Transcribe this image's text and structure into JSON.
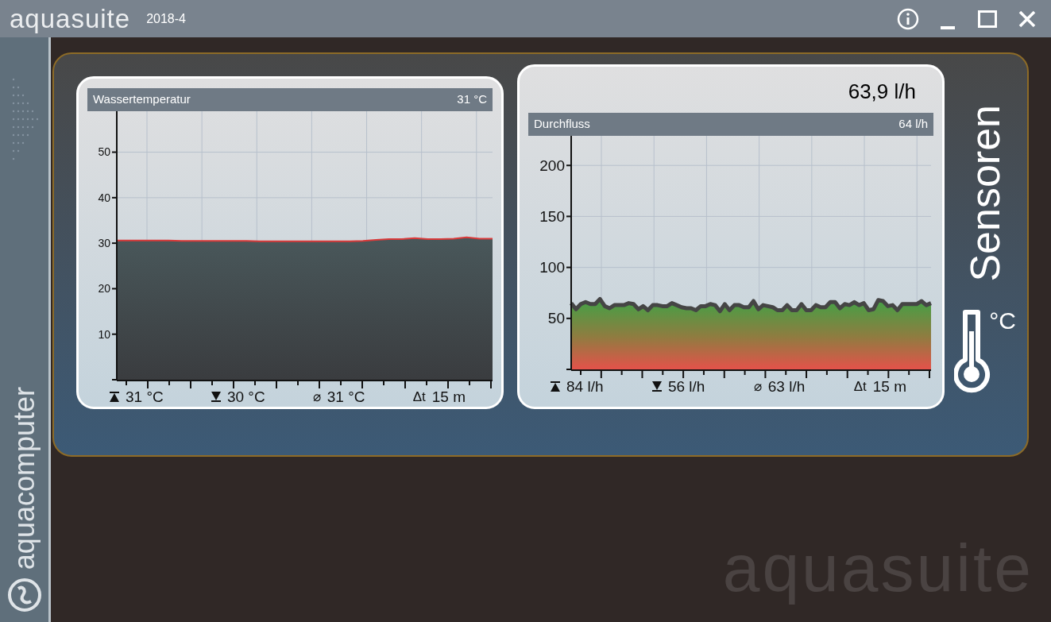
{
  "window": {
    "title": "aquasuite",
    "version": "2018-4"
  },
  "sidebar": {
    "brand": "aquacomputer"
  },
  "cards": [
    {
      "kind": "temperature",
      "title": "Wassertemperatur",
      "value": "31 °C",
      "chart_data": {
        "type": "area",
        "grid": true,
        "ylim": [
          0,
          59
        ],
        "yticks": [
          10,
          20,
          30,
          40,
          50
        ],
        "series": [
          {
            "color": "#d93a3a",
            "values": [
              30.6,
              30.6,
              30.6,
              30.6,
              30.6,
              30.5,
              30.5,
              30.5,
              30.5,
              30.5,
              30.5,
              30.4,
              30.4,
              30.4,
              30.4,
              30.4,
              30.4,
              30.4,
              30.4,
              30.5,
              30.7,
              30.9,
              30.9,
              31.1,
              30.9,
              30.9,
              31.0,
              31.3,
              31.0,
              31.0
            ]
          }
        ]
      },
      "stats": [
        {
          "kind": "max",
          "text": "31 °C"
        },
        {
          "kind": "min",
          "text": "30 °C"
        },
        {
          "kind": "avg",
          "symbol": "⌀",
          "text": "31 °C"
        },
        {
          "kind": "duration",
          "symbol": "Δt",
          "text": "15 m"
        }
      ]
    },
    {
      "kind": "flow",
      "reading": "63,9 l/h",
      "title": "Durchfluss",
      "value": "64 l/h",
      "chart_data": {
        "type": "area",
        "grid": true,
        "ylim": [
          0,
          229
        ],
        "yticks": [
          50,
          100,
          150,
          200
        ],
        "series": [
          {
            "color": "#454545",
            "values": [
              65,
              59,
              64,
              66,
              64,
              64,
              69,
              62,
              60,
              63,
              63,
              63,
              65,
              64,
              59,
              62,
              58,
              63,
              63,
              62,
              62,
              65,
              63,
              61,
              60,
              60,
              58,
              62,
              62,
              64,
              63,
              57,
              64,
              58,
              63,
              63,
              61,
              61,
              67,
              59,
              63,
              62,
              61,
              58,
              58,
              63,
              58,
              58,
              64,
              58,
              58,
              63,
              61,
              61,
              66,
              66,
              60,
              64,
              63,
              66,
              63,
              65,
              58,
              59,
              68,
              67,
              62,
              63,
              58,
              64,
              64,
              64,
              64,
              67,
              63,
              65
            ]
          }
        ]
      },
      "stats": [
        {
          "kind": "max",
          "text": "84 l/h"
        },
        {
          "kind": "min",
          "text": "56 l/h"
        },
        {
          "kind": "avg",
          "symbol": "⌀",
          "text": "63 l/h"
        },
        {
          "kind": "duration",
          "symbol": "Δt",
          "text": "15 m"
        }
      ]
    }
  ],
  "section": {
    "title": "Sensoren",
    "unit": "°C"
  },
  "footer_brand": "aquasuite"
}
